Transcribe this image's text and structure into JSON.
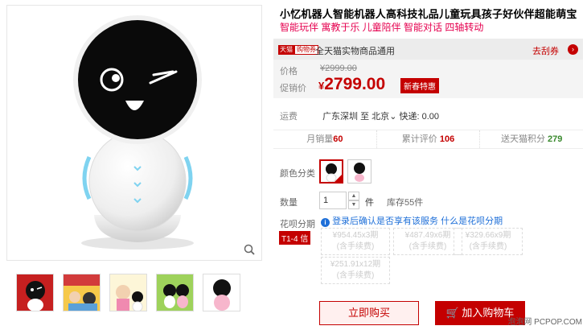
{
  "product": {
    "title": "小忆机器人智能机器人高科技礼品儿童玩具孩子好伙伴超能萌宝",
    "subtitle": "智能玩伴 寓教于乐 儿童陪伴 智能对话 四轴转动"
  },
  "promo": {
    "badge_left": "天猫",
    "badge_right": "购物券",
    "text": "全天猫实物商品通用",
    "coupon_link": "去刮券",
    "coupon_arrow": "›",
    "price_label": "价格",
    "original_price": "¥2999.00",
    "promo_label": "促销价",
    "currency": "¥",
    "promo_price": "2799.00",
    "promo_tag": "新春特惠"
  },
  "shipping": {
    "label": "运费",
    "route": "广东深圳 至 北京",
    "route_chevron": "⌄",
    "express": "快递: 0.00"
  },
  "stats": {
    "monthly_sales_label": "月销量",
    "monthly_sales": "60",
    "reviews_label": "累计评价",
    "reviews": "106",
    "points_label": "送天猫积分",
    "points": "279"
  },
  "options": {
    "color_label": "颜色分类",
    "qty_label": "数量",
    "qty_value": "1",
    "qty_unit": "件",
    "stock": "库存55件",
    "up_icon": "▲",
    "down_icon": "▼"
  },
  "huabei": {
    "label": "花呗分期",
    "info_icon": "i",
    "notice_a": "登录后确认是否享有该服务",
    "notice_link": "什么是花呗分期",
    "t14": "T1-4 信",
    "plans": [
      {
        "amount": "¥954.45x3期",
        "fee": "(含手续费)"
      },
      {
        "amount": "¥487.49x6期",
        "fee": "(含手续费)"
      },
      {
        "amount": "¥329.66x9期",
        "fee": "(含手续费)"
      },
      {
        "amount": "¥251.91x12期",
        "fee": "(含手续费)"
      }
    ]
  },
  "buttons": {
    "buy_now": "立即购买",
    "add_cart": "加入购物车",
    "cart_icon": "🛒"
  },
  "watermark": "泡泡网 PCPOP.COM",
  "colors": {
    "accent": "#c40000",
    "brand": "#e5004f",
    "link": "#1e6fd8"
  }
}
